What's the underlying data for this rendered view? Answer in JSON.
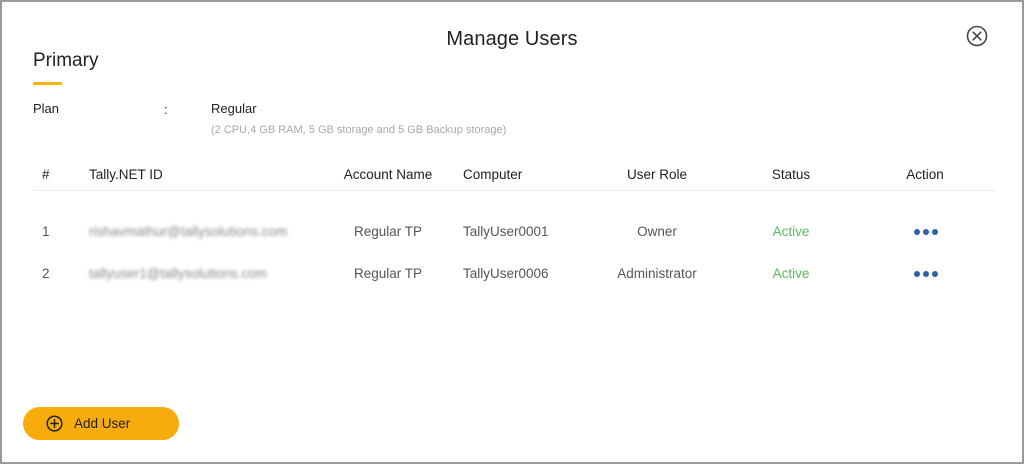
{
  "dialog": {
    "title": "Manage Users",
    "close_icon": "close-circle-icon"
  },
  "section": {
    "title": "Primary",
    "accent_color": "#f6b313"
  },
  "plan": {
    "label": "Plan",
    "separator": ":",
    "value": "Regular",
    "description": "(2 CPU,4 GB RAM, 5 GB storage and 5 GB Backup storage)"
  },
  "table": {
    "headers": {
      "index": "#",
      "tally_id": "Tally.NET ID",
      "account_name": "Account Name",
      "computer": "Computer",
      "user_role": "User Role",
      "status": "Status",
      "action": "Action"
    },
    "rows": [
      {
        "index": "1",
        "tally_id": "rishavmathur@tallysolutions.com",
        "account_name": "Regular TP",
        "computer": "TallyUser0001",
        "user_role": "Owner",
        "status": "Active",
        "action_icon": "more-horizontal-icon"
      },
      {
        "index": "2",
        "tally_id": "tallyuser1@tallysolutions.com",
        "account_name": "Regular TP",
        "computer": "TallyUser0006",
        "user_role": "Administrator",
        "status": "Active",
        "action_icon": "more-horizontal-icon"
      }
    ]
  },
  "footer": {
    "add_user_label": "Add User",
    "add_user_icon": "plus-circle-icon",
    "button_color": "#f7ac0b"
  },
  "colors": {
    "status_active": "#5cb85c",
    "action_dots": "#2f5faa"
  }
}
